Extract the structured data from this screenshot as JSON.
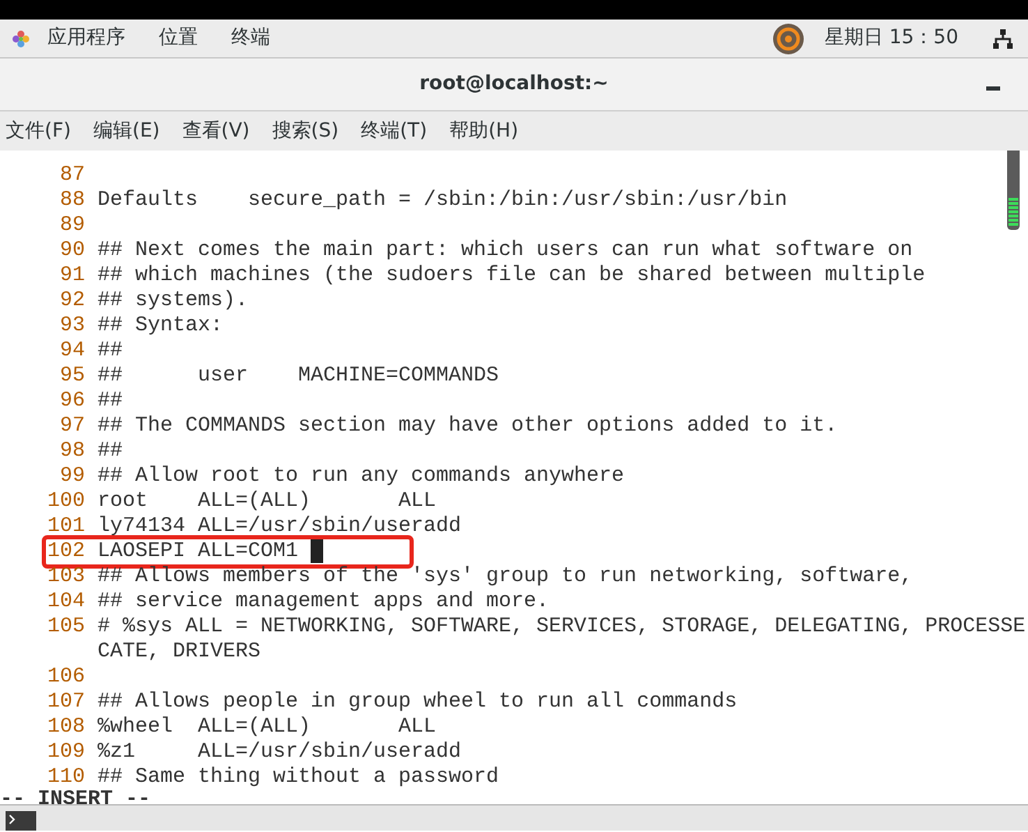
{
  "top_bar": {
    "menus": [
      "应用程序",
      "位置",
      "终端"
    ],
    "clock": "星期日 15：50"
  },
  "window": {
    "title": "root@localhost:~"
  },
  "menu_bar": [
    "文件(F)",
    "编辑(E)",
    "查看(V)",
    "搜索(S)",
    "终端(T)",
    "帮助(H)"
  ],
  "editor": {
    "lines": [
      {
        "number": "87"
      },
      {
        "number": "88",
        "text": "Defaults    secure_path = /sbin:/bin:/usr/sbin:/usr/bin"
      },
      {
        "number": "89"
      },
      {
        "number": "90",
        "text": "## Next comes the main part: which users can run what software on"
      },
      {
        "number": "91",
        "text": "## which machines (the sudoers file can be shared between multiple"
      },
      {
        "number": "92",
        "text": "## systems)."
      },
      {
        "number": "93",
        "text": "## Syntax:"
      },
      {
        "number": "94",
        "text": "##"
      },
      {
        "number": "95",
        "text": "##      user    MACHINE=COMMANDS"
      },
      {
        "number": "96",
        "text": "##"
      },
      {
        "number": "97",
        "text": "## The COMMANDS section may have other options added to it."
      },
      {
        "number": "98",
        "text": "##"
      },
      {
        "number": "99",
        "text": "## Allow root to run any commands anywhere"
      },
      {
        "number": "100",
        "text": "root    ALL=(ALL)       ALL"
      },
      {
        "number": "101",
        "text": "ly74134 ALL=/usr/sbin/useradd"
      },
      {
        "number": "102",
        "text": "LAOSEPI ALL=COM1",
        "cursor": true,
        "highlighted": true
      },
      {
        "number": "103",
        "text": "## Allows members of the 'sys' group to run networking, software,"
      },
      {
        "number": "104",
        "text": "## service management apps and more."
      },
      {
        "number": "105",
        "text": "# %sys ALL = NETWORKING, SOFTWARE, SERVICES, STORAGE, DELEGATING, PROCESSE",
        "continuation": "CATE, DRIVERS"
      },
      {
        "number": "106"
      },
      {
        "number": "107",
        "text": "## Allows people in group wheel to run all commands"
      },
      {
        "number": "108",
        "text": "%wheel  ALL=(ALL)       ALL"
      },
      {
        "number": "109",
        "text": "%z1     ALL=/usr/sbin/useradd"
      },
      {
        "number": "110",
        "text": "## Same thing without a password"
      }
    ],
    "mode": "-- INSERT --"
  }
}
